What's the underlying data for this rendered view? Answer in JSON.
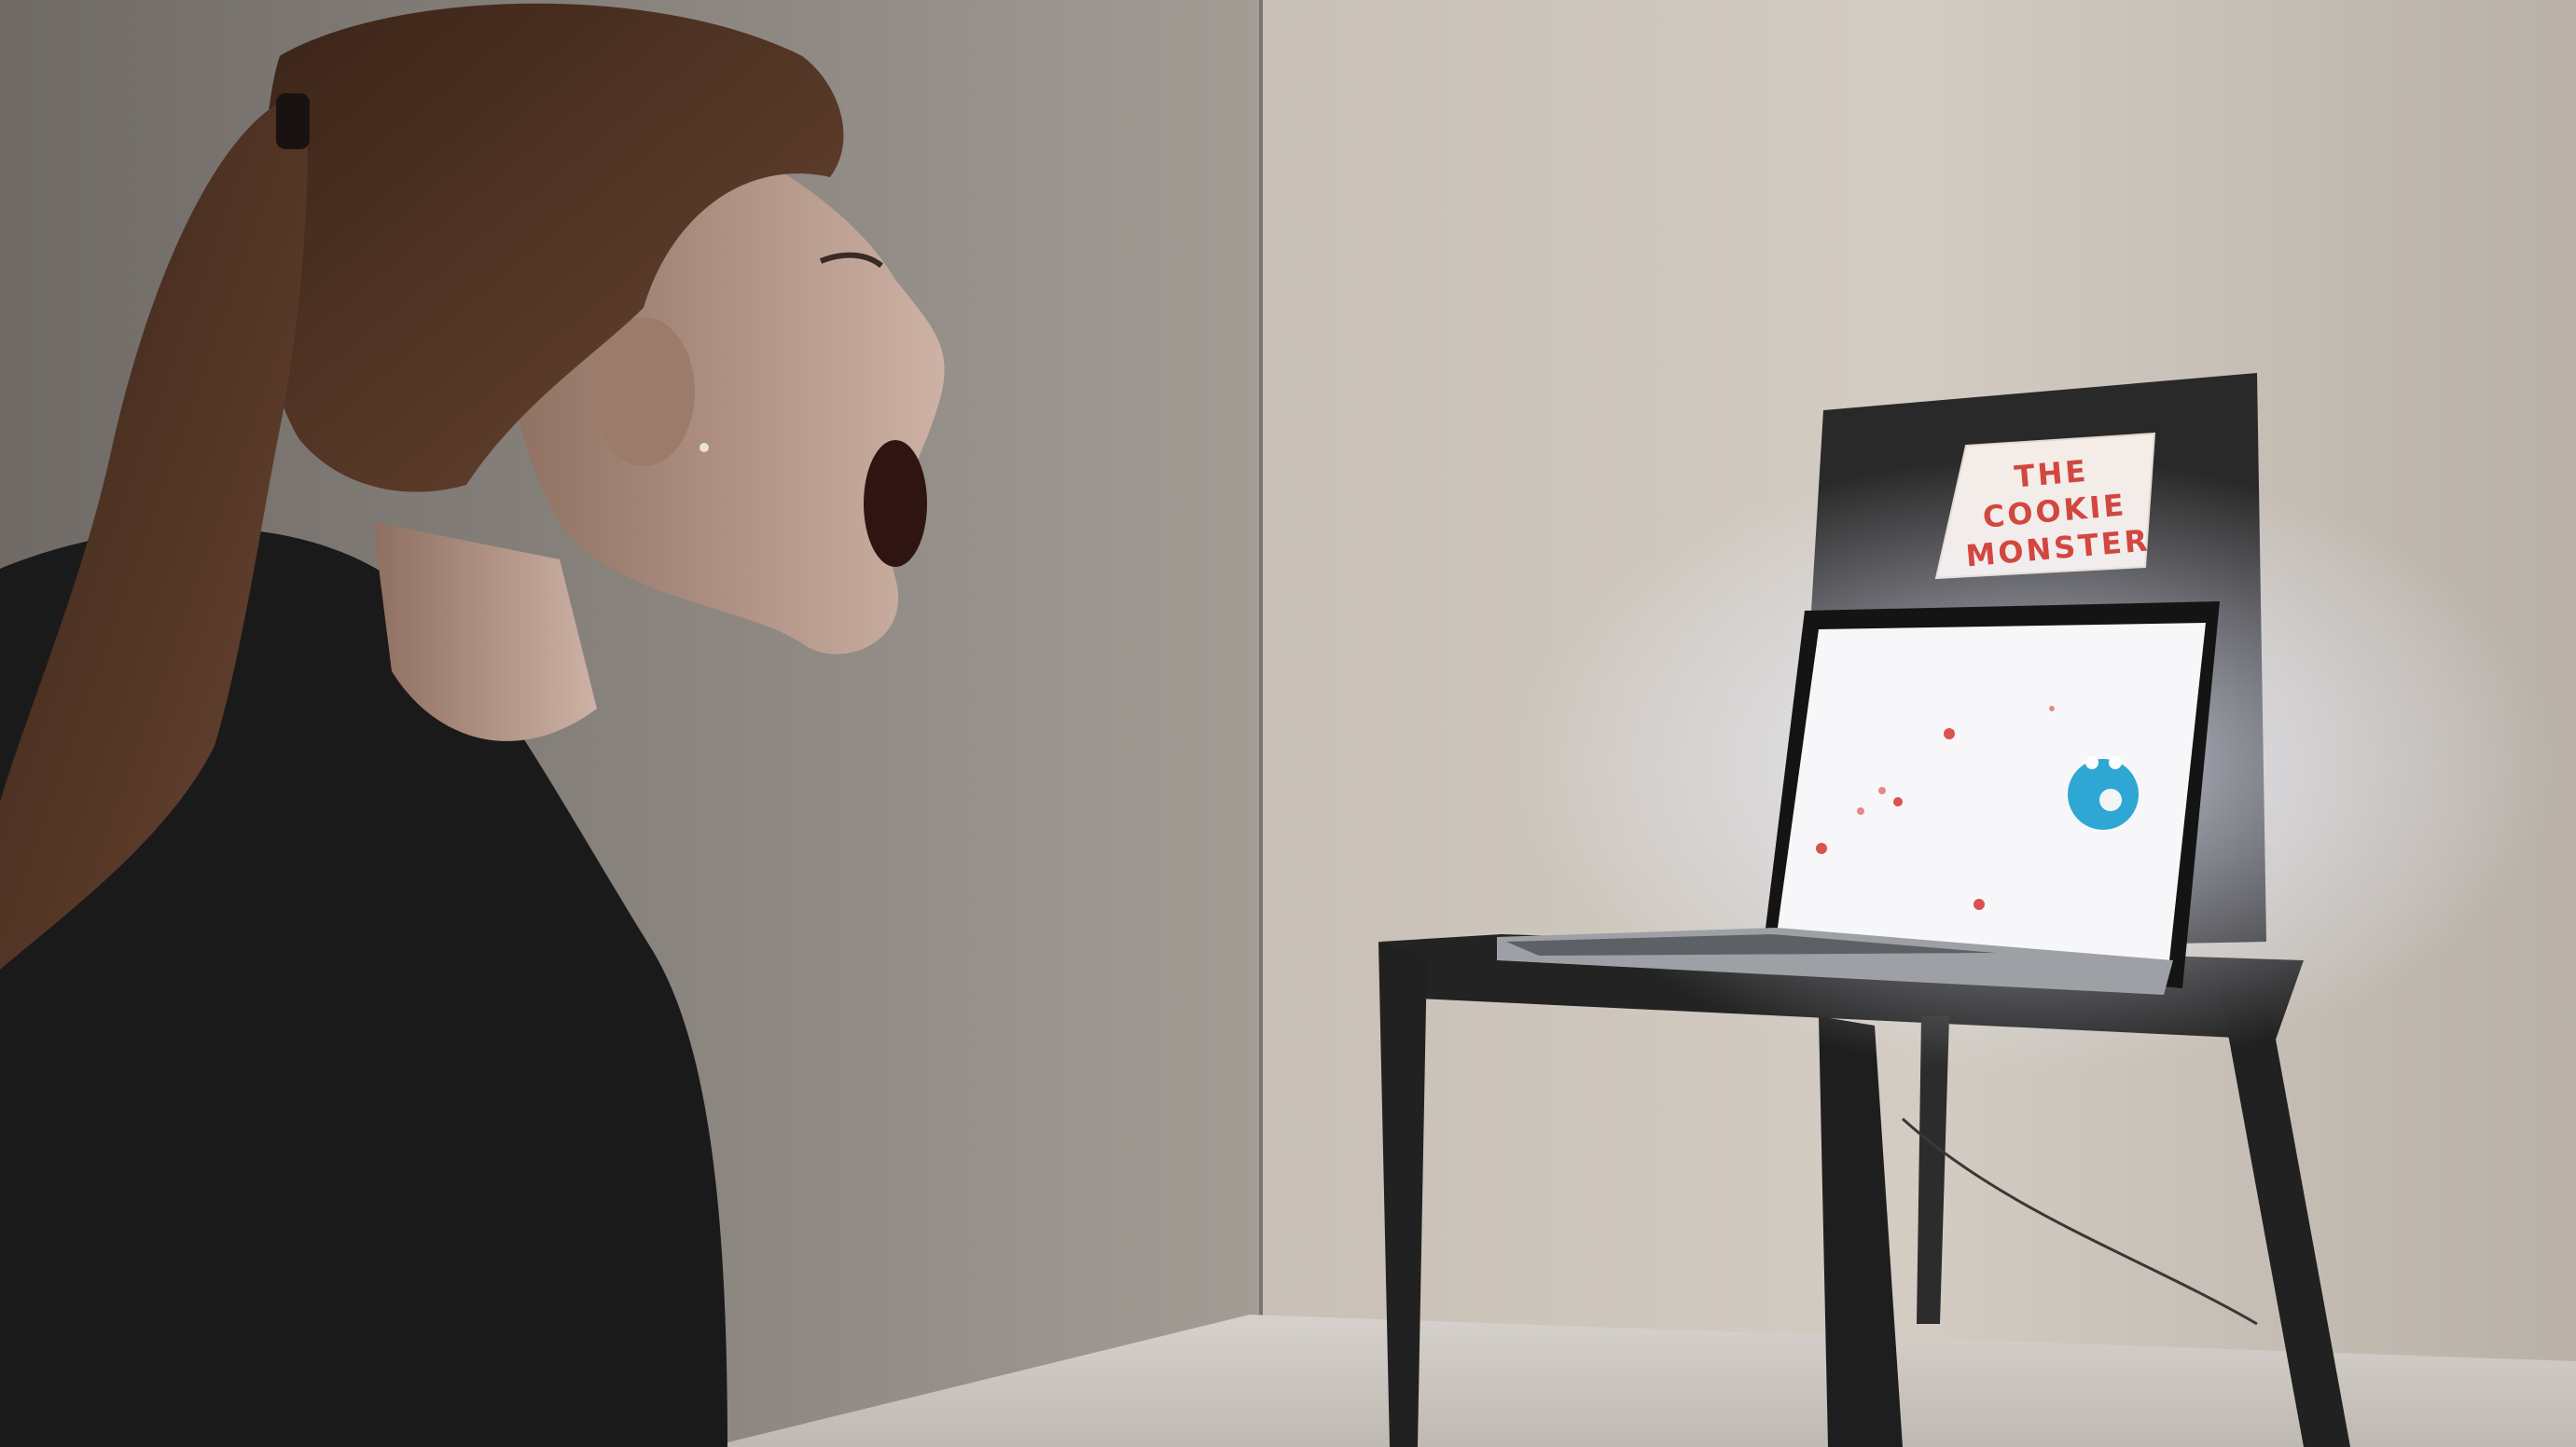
{
  "scene": {
    "subject": "person facing a laptop with mouth wide open",
    "sign": {
      "lines": [
        "THE COOKIE",
        "MONSTER"
      ],
      "text_color": "#d2473f"
    },
    "game_screen": {
      "background": "#f7f7f9",
      "monster_color": "#2fa7d4",
      "cookie_color": "#d9534f"
    },
    "colors": {
      "wall_left": "#8f8a84",
      "wall_right": "#c9c1b8",
      "chair": "#2b2a2b",
      "shirt": "#1b1a1a",
      "hair": "#4a3022",
      "skin": "#b49584"
    }
  }
}
